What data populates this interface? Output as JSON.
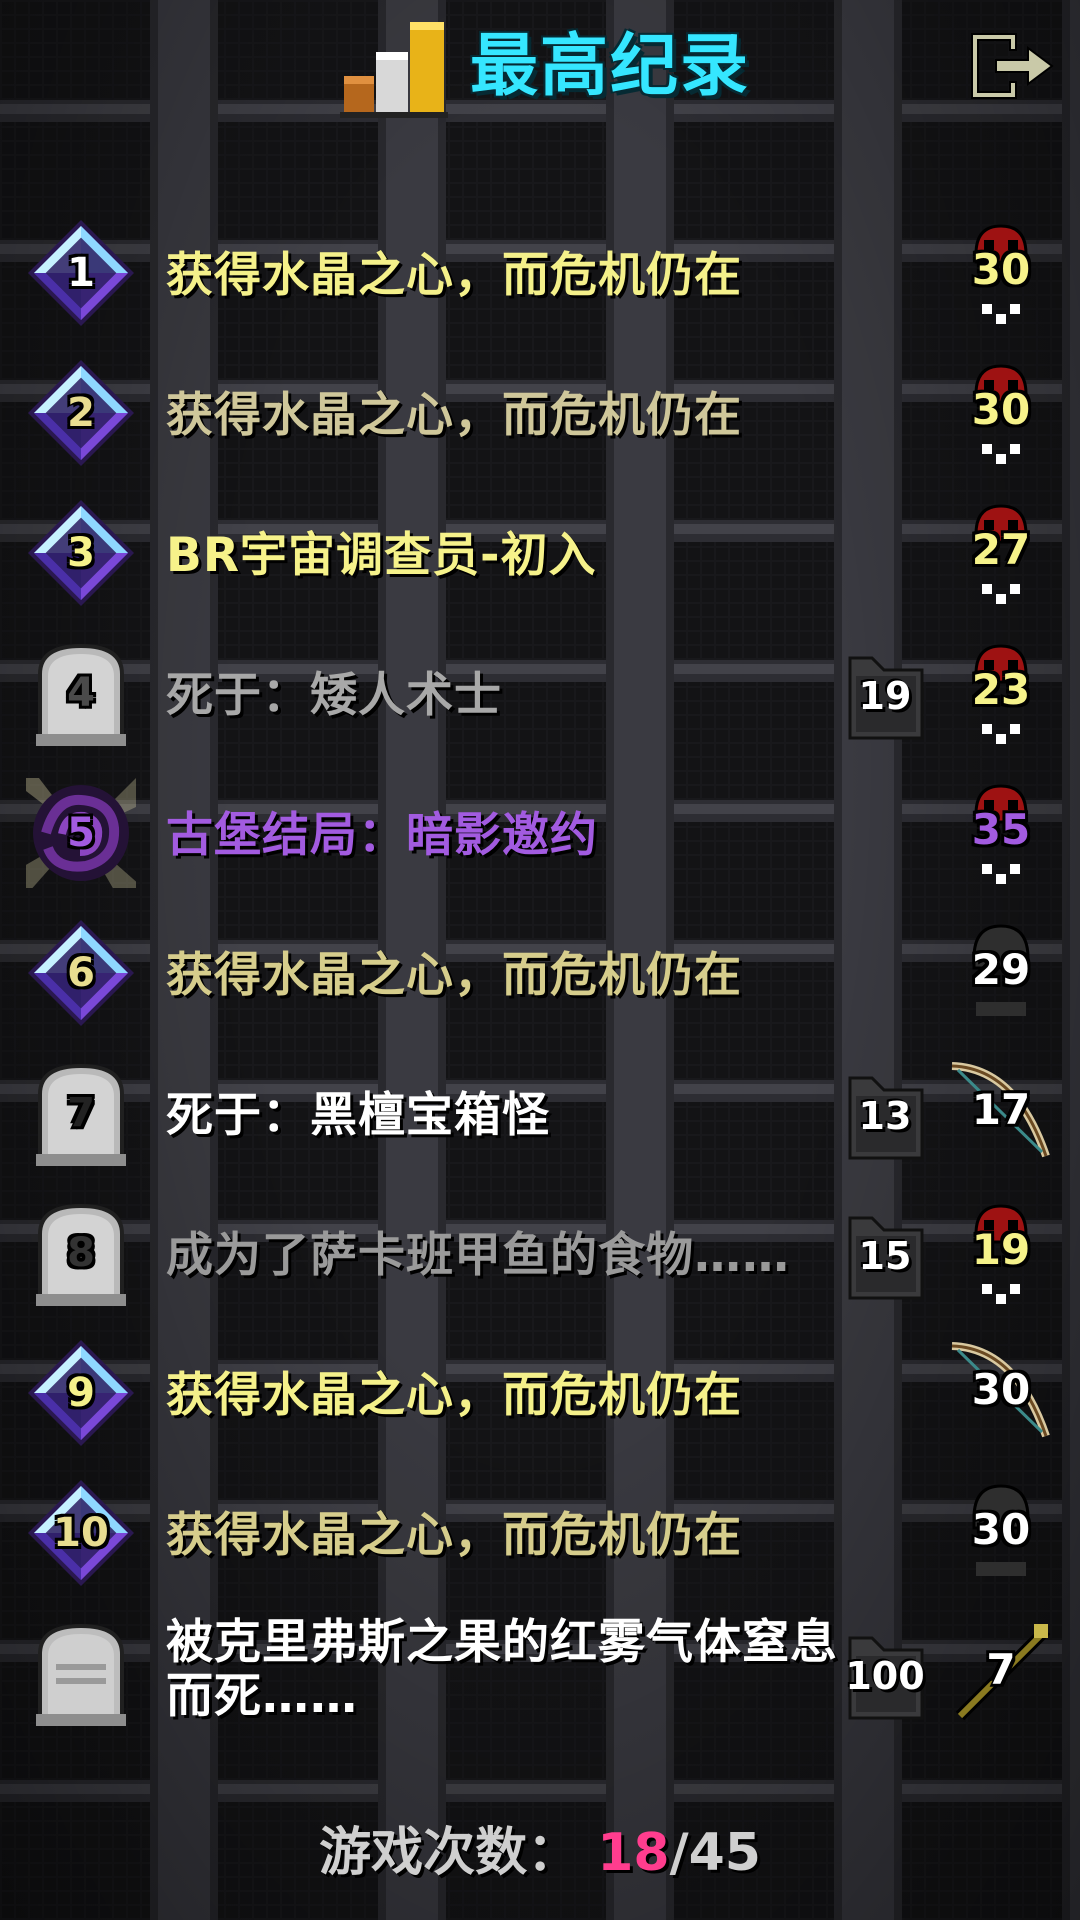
{
  "header": {
    "title": "最高纪录",
    "exit_icon": "exit-door-icon",
    "stats_icon": "bar-chart-icon"
  },
  "colors": {
    "title": "#35e6ff",
    "current_count": "#ff3d8e"
  },
  "records": [
    {
      "rank": "1",
      "desc": "获得水晶之心，而危机仍在",
      "badge": "crystal",
      "score": "30",
      "score_icon": "skull",
      "depth": "",
      "desc_color": "#f4f08a",
      "num_color": "#ffffff"
    },
    {
      "rank": "2",
      "desc": "获得水晶之心，而危机仍在",
      "badge": "crystal",
      "score": "30",
      "score_icon": "skull",
      "depth": "",
      "desc_color": "#cfc79a",
      "num_color": "#e8dd90"
    },
    {
      "rank": "3",
      "desc": "BR宇宙调查员-初入",
      "badge": "crystal",
      "score": "27",
      "score_icon": "skull",
      "depth": "",
      "desc_color": "#f6f28a",
      "num_color": "#f6f28a"
    },
    {
      "rank": "4",
      "desc": "死于：矮人术士",
      "badge": "grave",
      "score": "23",
      "score_icon": "skull",
      "depth": "19",
      "desc_color": "#a8a8a8",
      "num_color": "#4a4a4a"
    },
    {
      "rank": "5",
      "desc": "古堡结局：暗影邀约",
      "badge": "shadow",
      "score": "35",
      "score_icon": "skull",
      "depth": "",
      "desc_color": "#a25be0",
      "num_color": "#a25be0"
    },
    {
      "rank": "6",
      "desc": "获得水晶之心，而危机仍在",
      "badge": "crystal",
      "score": "29",
      "score_icon": "helm",
      "depth": "",
      "desc_color": "#d6cd8c",
      "num_color": "#e8dd90"
    },
    {
      "rank": "7",
      "desc": "死于：黑檀宝箱怪",
      "badge": "grave",
      "score": "17",
      "score_icon": "bow",
      "depth": "13",
      "desc_color": "#ffffff",
      "num_color": "#222222"
    },
    {
      "rank": "8",
      "desc": "成为了萨卡班甲鱼的食物……",
      "badge": "grave",
      "score": "19",
      "score_icon": "skull",
      "depth": "15",
      "desc_color": "#9a9a9a",
      "num_color": "#333333"
    },
    {
      "rank": "9",
      "desc": "获得水晶之心，而危机仍在",
      "badge": "crystal",
      "score": "30",
      "score_icon": "bow",
      "depth": "",
      "desc_color": "#f4f08a",
      "num_color": "#f4f08a"
    },
    {
      "rank": "10",
      "desc": "获得水晶之心，而危机仍在",
      "badge": "crystal",
      "score": "30",
      "score_icon": "helm",
      "depth": "",
      "desc_color": "#d6cd8c",
      "num_color": "#e8dd90"
    },
    {
      "rank": "",
      "desc": "被克里弗斯之果的红雾气体窒息而死……",
      "badge": "grave-blank",
      "score": "7",
      "score_icon": "staff",
      "depth": "100",
      "desc_color": "#ffffff",
      "num_color": "#222222"
    }
  ],
  "footer": {
    "label": "游戏次数：",
    "current": "18",
    "sep": "/",
    "total": "45"
  }
}
